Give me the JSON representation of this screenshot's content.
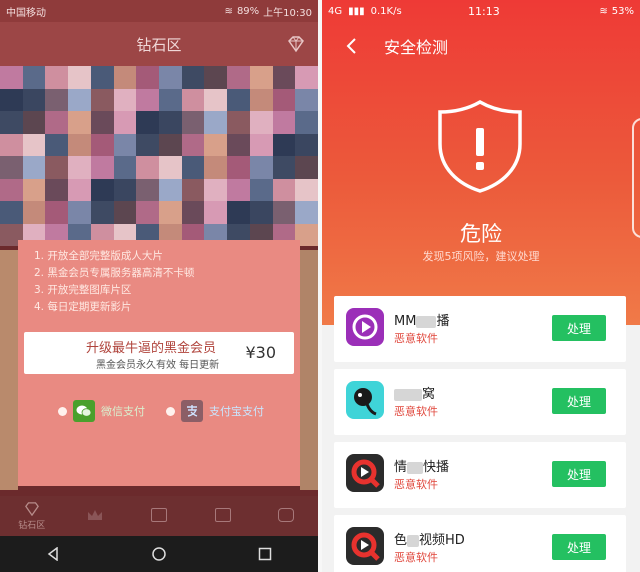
{
  "left": {
    "status": {
      "carrier": "中国移动",
      "battery": "89%",
      "time": "上午10:30"
    },
    "title": "钻石区",
    "popup": {
      "benefits": [
        "1. 开放全部完整版成人大片",
        "2. 黑金会员专属服务器高清不卡顿",
        "3. 开放完整图库片区",
        "4. 每日定期更新影片"
      ],
      "vip_title": "升级最牛逼的黑金会员",
      "vip_sub": "黑金会员永久有效 每日更新",
      "price": "¥30",
      "pay_wechat": "微信支付",
      "pay_alipay": "支付宝支付"
    },
    "tabs": [
      {
        "label": "钻石区"
      },
      {
        "label": ""
      },
      {
        "label": ""
      },
      {
        "label": ""
      },
      {
        "label": ""
      }
    ]
  },
  "right": {
    "status": {
      "left": "4G",
      "net": "0.1K/s",
      "time": "11:13",
      "battery": "53%"
    },
    "title": "安全检测",
    "danger": "危险",
    "danger_sub": "发现5项风险，建议处理",
    "apps": [
      {
        "pre": "MM",
        "post": "播",
        "risk": "恶意软件",
        "action": "处理",
        "icon": "video-play-icon"
      },
      {
        "pre": "",
        "post": "窝",
        "risk": "恶意软件",
        "action": "处理",
        "icon": "tadpole-app-icon"
      },
      {
        "pre": "情",
        "post": "快播",
        "risk": "恶意软件",
        "action": "处理",
        "icon": "qvod-player-icon"
      },
      {
        "pre": "色",
        "post": "视频HD",
        "risk": "恶意软件",
        "action": "处理",
        "icon": "qvod-player-icon"
      }
    ]
  }
}
